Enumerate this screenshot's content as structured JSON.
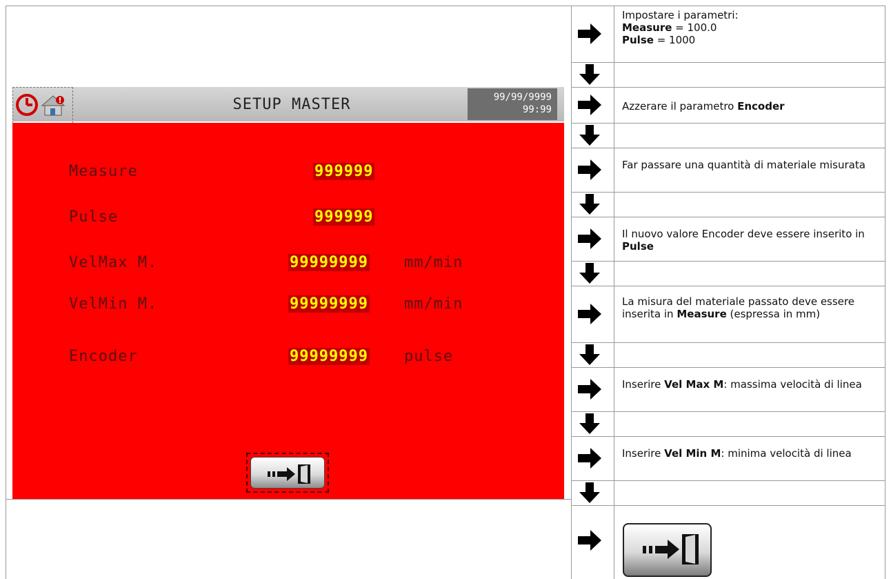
{
  "hmi": {
    "title": "SETUP MASTER",
    "date": "99/99/9999",
    "time": "99:99",
    "icons": [
      "clock-icon",
      "home-alert-icon",
      "exit-door-icon"
    ],
    "colors": {
      "background": "#ff0000",
      "value_text": "#ffff00",
      "header": "#c8c8c8"
    },
    "fields": [
      {
        "label": "Measure",
        "value": "999999",
        "unit": ""
      },
      {
        "label": "Pulse",
        "value": "999999",
        "unit": ""
      },
      {
        "label": "VelMax M.",
        "value": "99999999",
        "unit": "mm/min"
      },
      {
        "label": "VelMin M.",
        "value": "99999999",
        "unit": "mm/min"
      },
      {
        "label": "Encoder",
        "value": "99999999",
        "unit": "pulse"
      }
    ]
  },
  "steps": {
    "s1": {
      "intro": "Impostare i parametri:",
      "k1": "Measure",
      "v1": " = 100.0",
      "k2": "Pulse",
      "v2": " = 1000"
    },
    "s2": {
      "t1": "Azzerare il parametro ",
      "b1": "Encoder"
    },
    "s3": {
      "t1": "Far passare una quantità di materiale misurata"
    },
    "s4": {
      "t1": "Il nuovo valore Encoder deve essere inserito in ",
      "b1": "Pulse"
    },
    "s5": {
      "t1": "La misura del materiale passato deve essere inserita in ",
      "b1": "Measure",
      "t2": " (espressa in mm)"
    },
    "s6": {
      "t1": "Inserire ",
      "b1": "Vel Max M",
      "t2": ": massima velocità di linea"
    },
    "s7": {
      "t1": "Inserire ",
      "b1": "Vel Min M",
      "t2": ": minima velocità di linea"
    }
  }
}
